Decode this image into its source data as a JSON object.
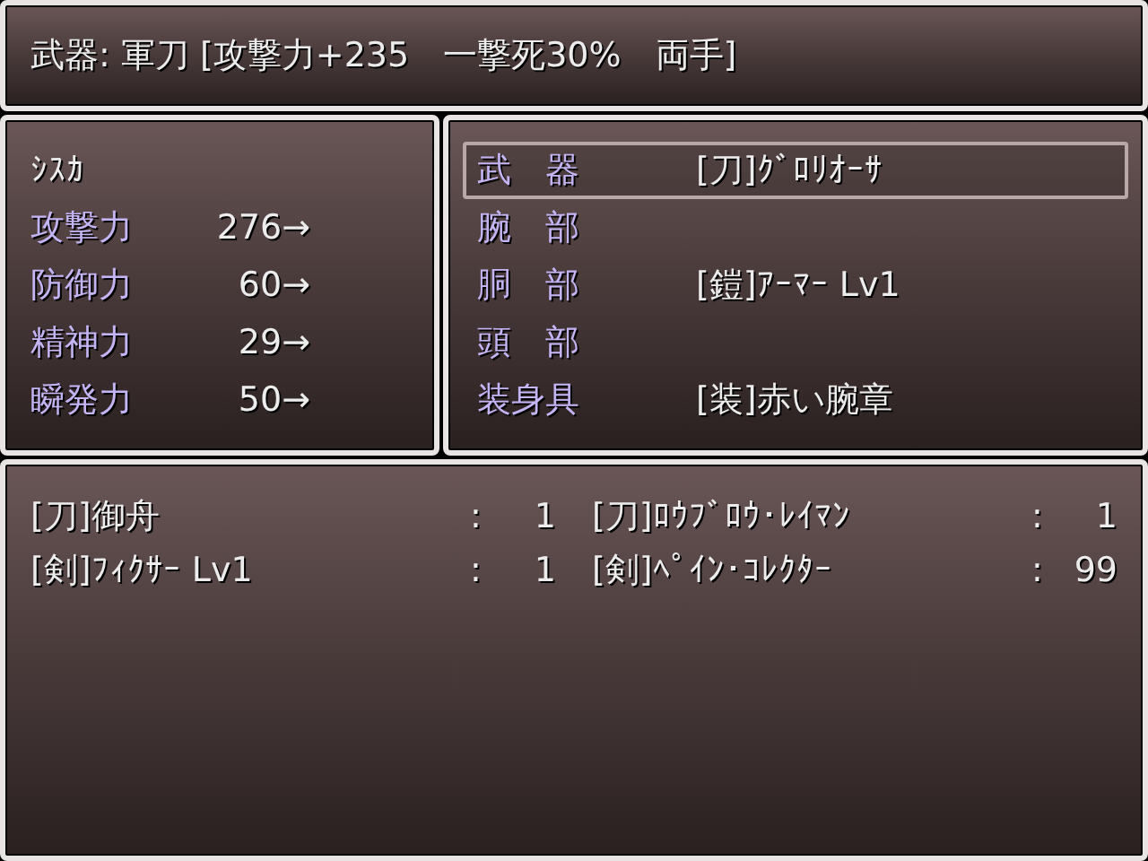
{
  "help": {
    "text": "武器: 軍刀 [攻撃力+235　一撃死30%　両手]"
  },
  "status": {
    "actor": "ｼｽｶ",
    "stats": [
      {
        "label": "攻撃力",
        "value": "276→"
      },
      {
        "label": "防御力",
        "value": "60→"
      },
      {
        "label": "精神力",
        "value": "29→"
      },
      {
        "label": "瞬発力",
        "value": "50→"
      }
    ]
  },
  "slots": [
    {
      "label": "武　器",
      "item": "[刀]ｸﾞﾛﾘｵｰｻ",
      "selected": true
    },
    {
      "label": "腕　部",
      "selected": false
    },
    {
      "label": "胴　部",
      "item": "[鎧]ｱｰﾏｰ Lv1",
      "selected": false
    },
    {
      "label": "頭　部",
      "selected": false
    },
    {
      "label": "装身具",
      "item": "[装]赤い腕章",
      "selected": false
    }
  ],
  "inventory": [
    {
      "name": "[刀]御舟",
      "separator": ":",
      "count": "1"
    },
    {
      "name": "[刀]ﾛｳﾌﾞﾛｳ･ﾚｲﾏﾝ",
      "separator": ":",
      "count": "1"
    },
    {
      "name": "[剣]ﾌｨｸｻｰ Lv1",
      "separator": ":",
      "count": "1"
    },
    {
      "name": "[剣]ﾍﾟｲﾝ･ｺﾚｸﾀｰ",
      "separator": ":",
      "count": "99"
    }
  ]
}
